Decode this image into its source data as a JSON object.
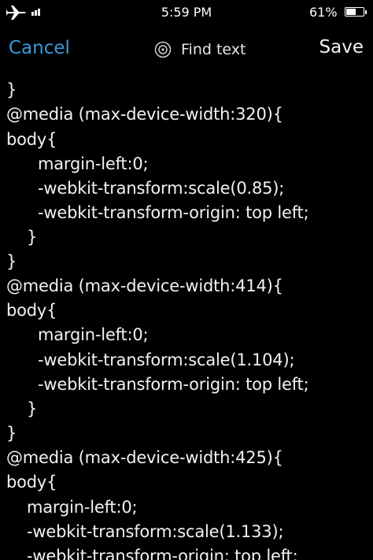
{
  "status_bar": {
    "time": "5:59 PM",
    "battery_percent": "61%",
    "battery_level": 0.61,
    "icons": [
      "airplane-icon",
      "signal-icon",
      "battery-icon"
    ]
  },
  "nav_bar": {
    "cancel_label": "Cancel",
    "find_label": "Find text",
    "save_label": "Save",
    "accent_color": "#3a9bd9"
  },
  "editor": {
    "lines": [
      "}",
      "@media (max-device-width:320){",
      "body{",
      "margin-left:0;",
      "-webkit-transform:scale(0.85);",
      "-webkit-transform-origin: top left;",
      "}",
      "}",
      "@media (max-device-width:414){",
      "body{",
      "margin-left:0;",
      "-webkit-transform:scale(1.104);",
      "-webkit-transform-origin: top left;",
      "}",
      "}",
      "@media (max-device-width:425){",
      "body{",
      "margin-left:0;",
      "-webkit-transform:scale(1.133);",
      "-webkit-transform-origin: top left;"
    ]
  }
}
